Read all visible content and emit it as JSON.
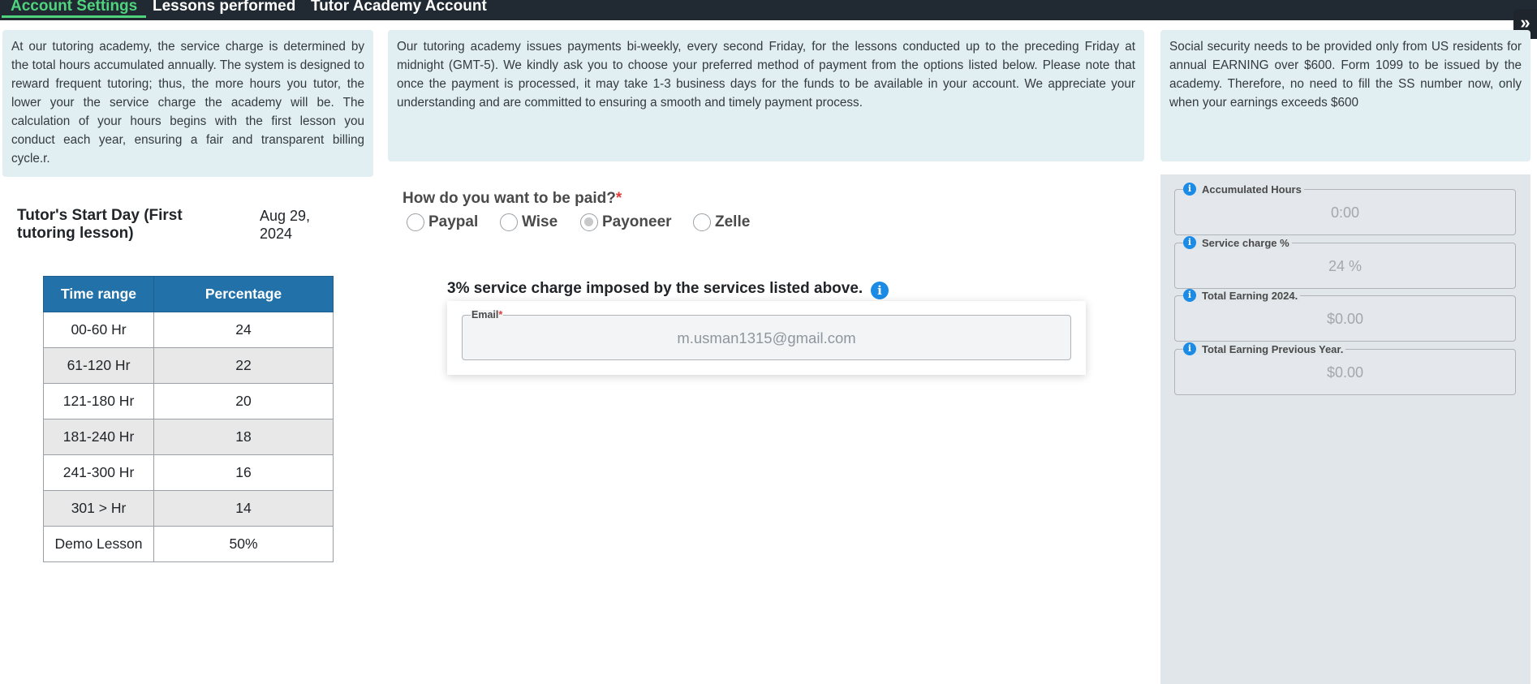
{
  "nav": {
    "tabs": [
      {
        "label": "Account Settings",
        "active": true
      },
      {
        "label": "Lessons performed",
        "active": false
      },
      {
        "label": "Tutor Academy Account",
        "active": false
      }
    ],
    "toggle_glyph": "»"
  },
  "info": {
    "service_charge_text": "At our tutoring academy, the service charge is determined by the total hours accumulated annually. The system is designed to reward frequent tutoring; thus, the more hours you tutor, the lower your the service charge the academy will be. The calculation of your hours begins with the first lesson you conduct each year, ensuring a fair and transparent billing cycle.r.",
    "payments_text": "Our tutoring academy issues payments bi-weekly, every second Friday, for the lessons conducted up to the preceding Friday at midnight (GMT-5). We kindly ask you to choose your preferred method of payment from the options listed below. Please note that once the payment is processed, it may take 1-3 business days for the funds to be available in your account. We appreciate your understanding and are committed to ensuring a smooth and timely payment process.",
    "social_security_text": "Social security needs to be provided only from US residents for annual EARNING over $600. Form 1099 to be issued by the academy. Therefore, no need to fill the SS number now, only when your earnings exceeds $600"
  },
  "start_day": {
    "label": "Tutor's Start Day (First tutoring lesson)",
    "value": "Aug 29, 2024"
  },
  "rate_table": {
    "headers": [
      "Time range",
      "Percentage"
    ],
    "rows": [
      [
        "00-60 Hr",
        "24"
      ],
      [
        "61-120 Hr",
        "22"
      ],
      [
        "121-180 Hr",
        "20"
      ],
      [
        "181-240 Hr",
        "18"
      ],
      [
        "241-300 Hr",
        "16"
      ],
      [
        "301 > Hr",
        "14"
      ],
      [
        "Demo Lesson",
        "50%"
      ]
    ]
  },
  "payment": {
    "question": "How do you want to be paid?",
    "required_mark": "*",
    "options": [
      {
        "label": "Paypal",
        "checked": false
      },
      {
        "label": "Wise",
        "checked": false
      },
      {
        "label": "Payoneer",
        "checked": true
      },
      {
        "label": "Zelle",
        "checked": false
      }
    ],
    "charge_note": "3% service charge imposed by the services listed above.",
    "info_glyph": "i",
    "email_label": "Email",
    "email_value": "m.usman1315@gmail.com"
  },
  "stats": [
    {
      "label": "Accumulated Hours",
      "value": "0:00"
    },
    {
      "label": "Service charge %",
      "value": "24 %"
    },
    {
      "label": "Total Earning 2024.",
      "value": "$0.00"
    },
    {
      "label": "Total Earning Previous Year.",
      "value": "$0.00"
    }
  ],
  "colors": {
    "nav_bg": "#212a33",
    "active_tab": "#4fd47d",
    "info_bg": "#e1eef2",
    "table_header": "#2371a9",
    "info_icon": "#1b8be6",
    "required": "#e03c3c"
  }
}
